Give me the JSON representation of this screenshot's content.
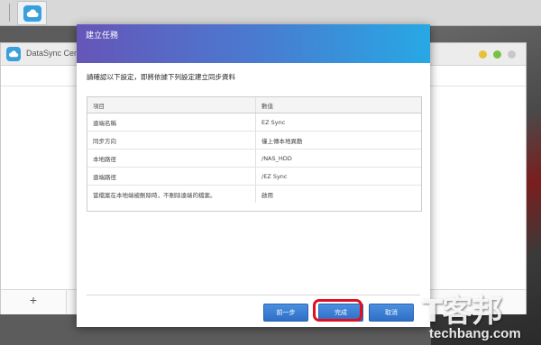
{
  "background_app": {
    "title": "DataSync Center",
    "add_label": "+",
    "window_dots": [
      "#e6c23a",
      "#7ac143",
      "#c8c8c8"
    ]
  },
  "dialog": {
    "title": "建立任務",
    "intro": "請確認以下設定，即將依據下列設定建立同步資料",
    "table": {
      "headers": [
        "項目",
        "數值"
      ],
      "rows": [
        [
          "遠端名稱",
          "EZ Sync"
        ],
        [
          "同步方向",
          "僅上傳本地異動"
        ],
        [
          "本地路徑",
          "/NAS_HDD"
        ],
        [
          "遠端路徑",
          "/EZ Sync"
        ],
        [
          "當檔案在本地端被刪除時，不刪除遠端的檔案。",
          "啟用"
        ]
      ]
    },
    "buttons": {
      "prev": "前一步",
      "finish": "完成",
      "cancel": "取消"
    },
    "header_gradient": [
      "#6655b8",
      "#27a8e4"
    ],
    "highlight_color": "#e01020"
  },
  "watermark": {
    "main": "T客邦",
    "sub": "techbang.com"
  }
}
